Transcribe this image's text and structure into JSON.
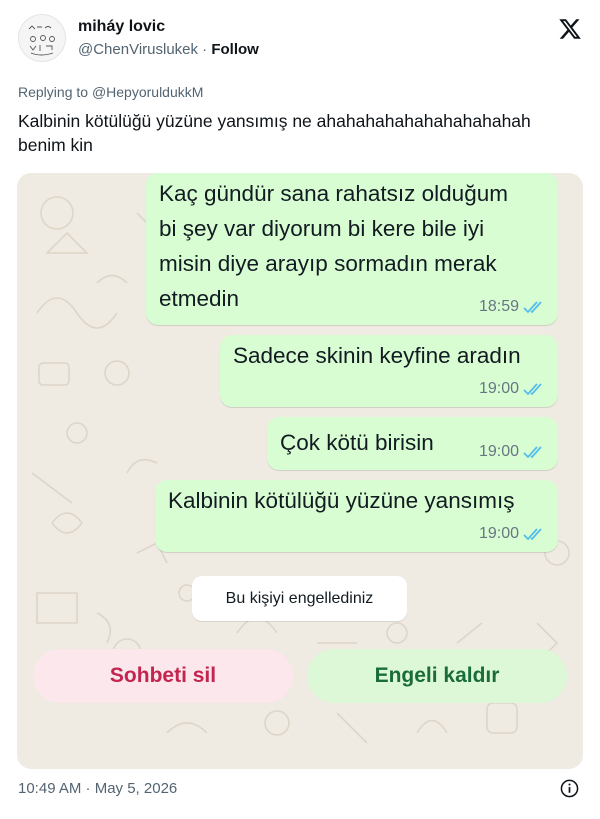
{
  "tweet": {
    "author_name": "miháy lovic",
    "handle": "@ChenViruslukek",
    "separator": " · ",
    "follow_label": "Follow",
    "replying_prefix": "Replying to ",
    "replying_to": "@HepyoruldukkM",
    "text": "Kalbinin kötülüğü yüzüne yansımış ne ahahahahahahahahahahah benim kin",
    "timestamp": "10:49 AM · May 5, 2026"
  },
  "chat": {
    "messages": [
      {
        "text": "Kaç gündür sana rahatsız olduğum\nbi şey var diyorum bi kere bile iyi\nmisin diye arayıp sormadın merak\netmedin",
        "time": "18:59"
      },
      {
        "text": "Sadece skinin keyfine aradın",
        "time": "19:00"
      },
      {
        "text": "Çok kötü birisin",
        "time": "19:00"
      },
      {
        "text": "Kalbinin kötülüğü yüzüne yansımış",
        "time": "19:00"
      }
    ],
    "blocked_notice": "Bu kişiyi engellediniz",
    "delete_chat_label": "Sohbeti sil",
    "unblock_label": "Engeli kaldır"
  },
  "colors": {
    "chat_background": "#efeae2",
    "outgoing_bubble": "#d9fdd3",
    "read_ticks": "#53bdeb",
    "delete_text": "#c4254f",
    "unblock_text": "#1a6c3b"
  }
}
